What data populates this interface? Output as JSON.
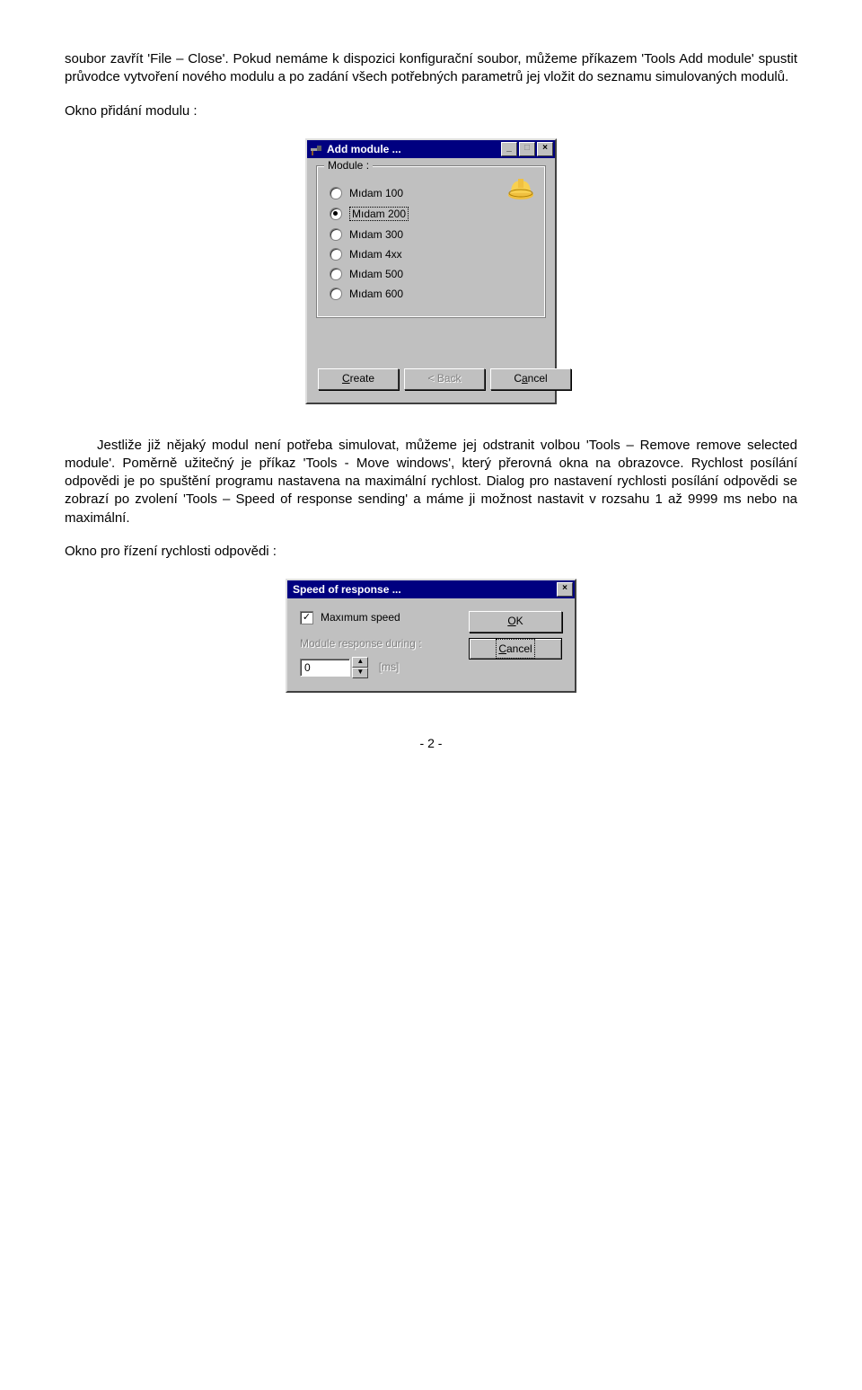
{
  "para1": "soubor zavřít 'File – Close'. Pokud nemáme k dispozici konfigurační soubor, můžeme příkazem 'Tools Add module' spustit průvodce vytvoření nového modulu a po zadání všech potřebných parametrů jej vložit do seznamu simulovaných modulů.",
  "label_add": "Okno přidání modulu :",
  "add_dialog": {
    "title": "Add module ...",
    "group_label": "Module :",
    "options": [
      "Mıdam 100",
      "Mıdam 200",
      "Mıdam 300",
      "Mıdam 4xx",
      "Mıdam 500",
      "Mıdam 600"
    ],
    "selected_index": 1,
    "buttons": {
      "create": "Create",
      "back": "< Back",
      "cancel": "Cancel"
    }
  },
  "para2": "Jestliže již nějaký modul není potřeba simulovat, můžeme jej odstranit volbou 'Tools – Remove remove selected module'. Poměrně užitečný je příkaz 'Tools - Move windows', který přerovná okna na obrazovce. Rychlost posílání odpovědi je po spuštění programu nastavena na maximální rychlost. Dialog pro nastavení rychlosti posílání odpovědi se zobrazí po zvolení 'Tools – Speed of response sending' a máme ji možnost nastavit v rozsahu 1 až 9999 ms nebo na maximální.",
  "label_speed": "Okno pro řízení rychlosti odpovědi :",
  "speed_dialog": {
    "title": "Speed of response ...",
    "checkbox_label": "Maxımum speed",
    "checkbox_checked": true,
    "during_label": "Module response during :",
    "value": "0",
    "unit": "[ms]",
    "ok": "OK",
    "cancel": "Cancel"
  },
  "page_footer": "- 2 -"
}
